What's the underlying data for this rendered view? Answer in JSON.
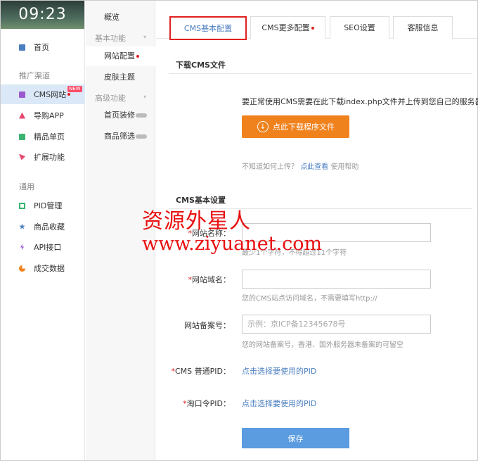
{
  "clock": "09:23",
  "sidebar": {
    "items": [
      {
        "label": "首页",
        "icon": "home-icon",
        "color": "#4a7ec0"
      },
      {
        "label": "CMS网站",
        "icon": "monitor-icon",
        "color": "#9b59d0",
        "badge": "NEW"
      },
      {
        "label": "导购APP",
        "icon": "app-icon",
        "color": "#e5486e"
      },
      {
        "label": "精品单页",
        "icon": "page-icon",
        "color": "#3cb371"
      },
      {
        "label": "扩展功能",
        "icon": "puzzle-icon",
        "color": "#e5486e"
      },
      {
        "label": "PID管理",
        "icon": "pid-icon",
        "color": "#3cb371"
      },
      {
        "label": "商品收藏",
        "icon": "star-icon",
        "color": "#4a7ec0"
      },
      {
        "label": "API接口",
        "icon": "api-icon",
        "color": "#9b59d0"
      },
      {
        "label": "成交数据",
        "icon": "chart-icon",
        "color": "#f0821e"
      }
    ],
    "sections": [
      "推广渠道",
      "通用"
    ]
  },
  "submenu": {
    "overview": "概览",
    "basic_section": "基本功能",
    "site_config": "网站配置",
    "skin": "皮肤主题",
    "advanced_section": "高级功能",
    "home_decor": "首页装修",
    "goods_filter": "商品筛选"
  },
  "tabs": [
    "CMS基本配置",
    "CMS更多配置",
    "SEO设置",
    "客服信息"
  ],
  "download": {
    "title": "下载CMS文件",
    "desc": "要正常使用CMS需要在此下载index.php文件并上传到您自己的服务器",
    "button": "点此下载程序文件",
    "help_prefix": "不知道如何上传？",
    "help_link": "点此查看",
    "help_suffix": "使用帮助"
  },
  "form": {
    "title": "CMS基本设置",
    "site_name_label": "网站名称：",
    "site_name_hint": "最少1个字符，不得超过11个字符",
    "domain_label": "网站域名：",
    "domain_hint": "您的CMS站点访问域名，不需要填写http://",
    "icp_label": "网站备案号：",
    "icp_placeholder": "示例：京ICP备12345678号",
    "icp_hint": "您的网站备案号，香港、国外服务器未备案的可留空",
    "cms_pid_label": "CMS 普通PID：",
    "cms_pid_link": "点击选择要使用的PID",
    "tkl_pid_label": "淘口令PID：",
    "tkl_pid_link": "点击选择要使用的PID",
    "save": "保存"
  },
  "watermark": {
    "line1": "资源外星人",
    "line2": "www.ziyuanet.com"
  },
  "colors": {
    "accent": "#4a7ec0",
    "orange": "#f0821e",
    "save_blue": "#5b9be0",
    "highlight_red": "#e02020"
  }
}
